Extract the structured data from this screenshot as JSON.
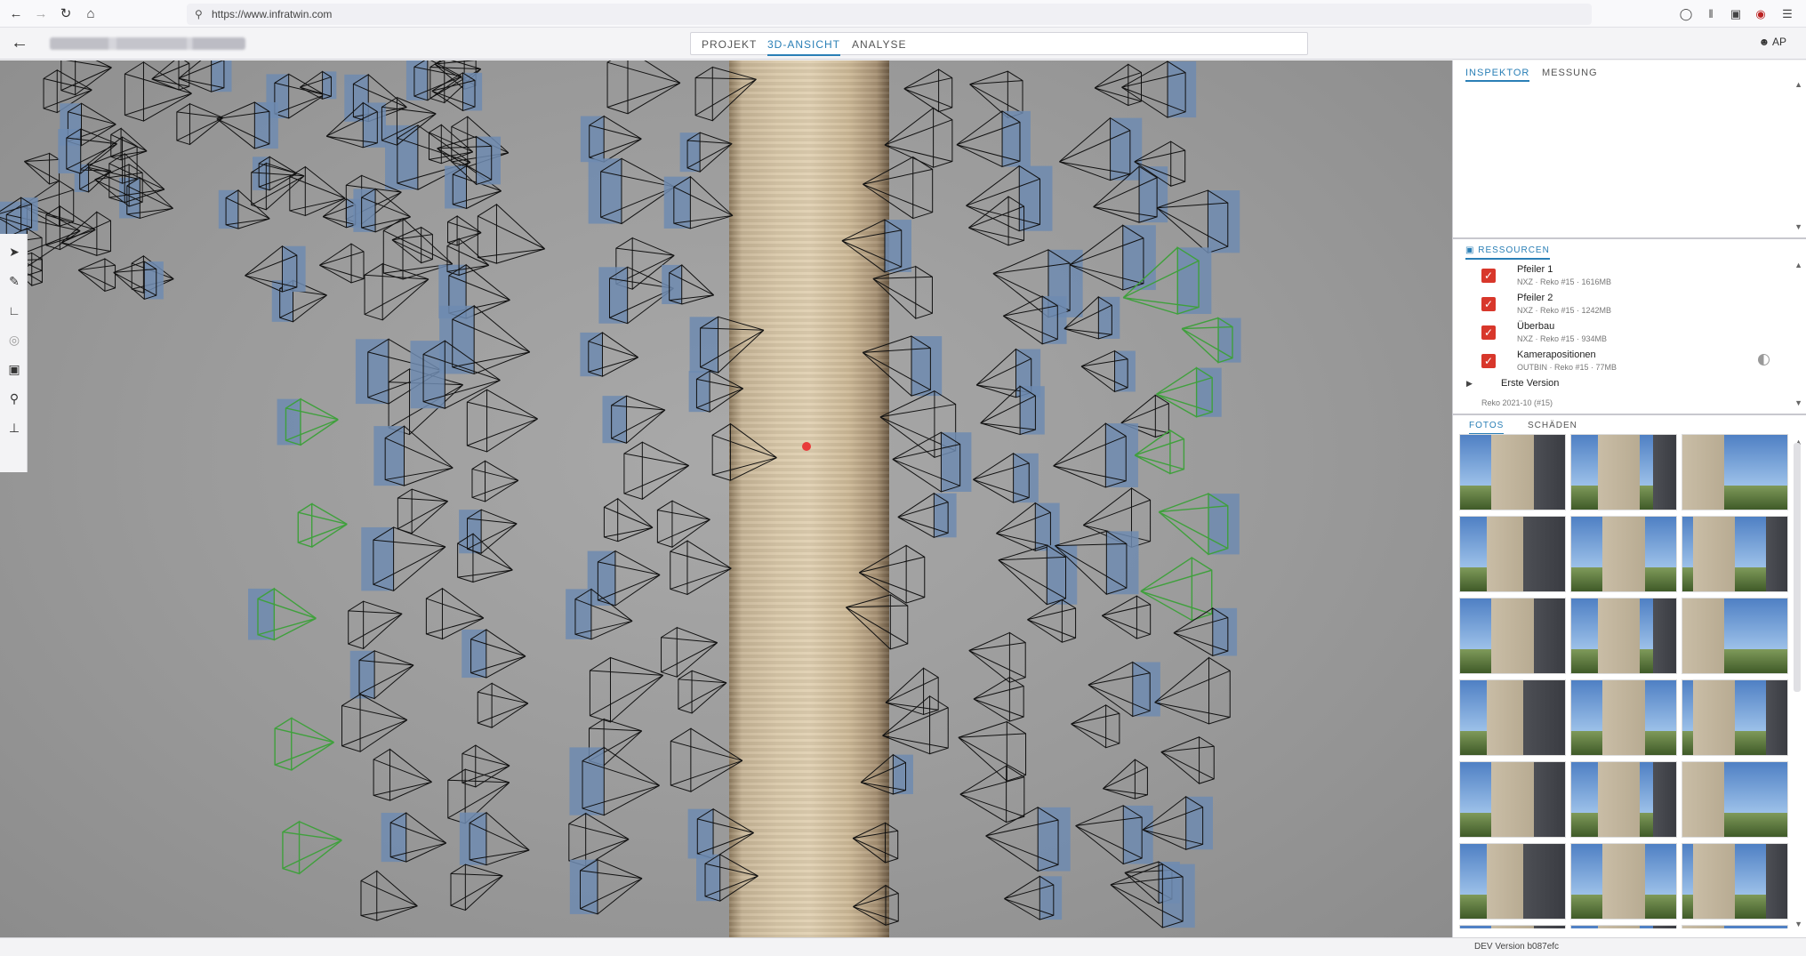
{
  "browser": {
    "url": "https://www.infratwin.com",
    "nav_icons": [
      "back-arrow-icon",
      "forward-arrow-icon",
      "reload-icon",
      "home-icon"
    ],
    "right_icons": [
      "pocket-icon",
      "library-icon",
      "reader-icon",
      "extension-icon",
      "menu-icon"
    ]
  },
  "header": {
    "tabs": [
      {
        "label": "PROJEKT",
        "active": false
      },
      {
        "label": "3D-ANSICHT",
        "active": true
      },
      {
        "label": "ANALYSE",
        "active": false
      }
    ],
    "user_initials": "AP"
  },
  "toolbar": {
    "tools": [
      "select-icon",
      "ruler-icon",
      "angle-measure-icon",
      "camera-target-icon",
      "camera-icon",
      "location-pin-icon",
      "axes-icon"
    ]
  },
  "inspector": {
    "tabs": [
      {
        "label": "INSPEKTOR",
        "active": true
      },
      {
        "label": "MESSUNG",
        "active": false
      }
    ]
  },
  "resources": {
    "title": "RESSOURCEN",
    "items": [
      {
        "name": "Pfeiler 1",
        "meta": "NXZ · Reko #15 · 1616MB"
      },
      {
        "name": "Pfeiler 2",
        "meta": "NXZ · Reko #15 · 1242MB"
      },
      {
        "name": "Überbau",
        "meta": "NXZ · Reko #15 · 934MB"
      },
      {
        "name": "Kamerapositionen",
        "meta": "OUTBIN · Reko #15 · 77MB"
      }
    ],
    "group_label": "Erste Version",
    "group_sub": "Reko 2021-10 (#15)"
  },
  "photos": {
    "tabs": [
      {
        "label": "FOTOS",
        "active": true
      },
      {
        "label": "SCHÄDEN",
        "active": false
      }
    ]
  },
  "status": {
    "version": "DEV Version b087efc"
  },
  "colors": {
    "accent": "#2a7fb6",
    "checkbox": "#d8372b",
    "selected_camera": "#3fa03c"
  }
}
